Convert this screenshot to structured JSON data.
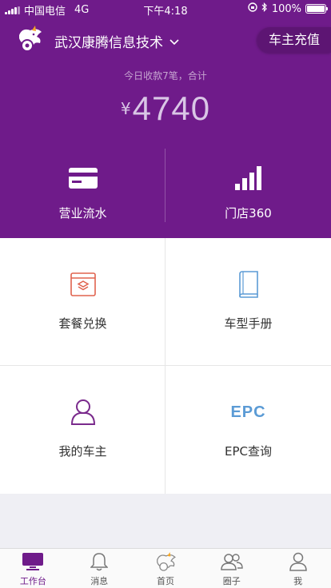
{
  "status_bar": {
    "carrier": "中国电信",
    "network": "4G",
    "time": "下午4:18",
    "battery": "100%",
    "battery_level": 1.0
  },
  "header": {
    "company_name": "武汉康腾信息技术",
    "recharge_button": "车主充值",
    "today_label": "今日收款7笔，合计",
    "currency_symbol": "¥",
    "amount": "4740",
    "quick_actions": [
      {
        "label": "营业流水",
        "icon": "card-icon"
      },
      {
        "label": "门店360",
        "icon": "bar-chart-icon"
      }
    ]
  },
  "grid": [
    {
      "label": "套餐兑换",
      "icon": "package-exchange-icon"
    },
    {
      "label": "车型手册",
      "icon": "manual-book-icon"
    },
    {
      "label": "我的车主",
      "icon": "user-outline-icon"
    },
    {
      "label": "EPC查询",
      "icon": "epc-icon",
      "icon_text": "EPC"
    }
  ],
  "tabbar": [
    {
      "label": "工作台",
      "icon": "monitor-icon",
      "active": true
    },
    {
      "label": "消息",
      "icon": "bell-icon",
      "active": false
    },
    {
      "label": "首页",
      "icon": "logo-icon",
      "active": false
    },
    {
      "label": "圈子",
      "icon": "group-icon",
      "active": false
    },
    {
      "label": "我",
      "icon": "person-icon",
      "active": false
    }
  ],
  "colors": {
    "brand_purple": "#6f1b8a",
    "grid_icon_red": "#e0634f",
    "grid_icon_blue": "#5b9bd5",
    "grid_icon_purple": "#7a2a8c"
  }
}
